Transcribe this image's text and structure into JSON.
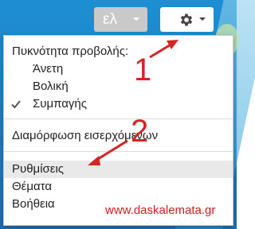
{
  "toolbar": {
    "language_label": "ελ",
    "language_icon": "chevron-down-icon",
    "settings_icon": "gear-icon"
  },
  "menu": {
    "density_header": "Πυκνότητα προβολής:",
    "density_options": [
      "Άνετη",
      "Βολική",
      "Συμπαγής"
    ],
    "selected_density": "Συμπαγής",
    "configure_inbox": "Διαμόρφωση εισερχόμενων",
    "settings": "Ρυθμίσεις",
    "themes": "Θέματα",
    "help": "Βοήθεια"
  },
  "annotations": {
    "step1": "1",
    "step2": "2",
    "watermark": "www.daskalemata.gr",
    "color": "#d42424"
  }
}
